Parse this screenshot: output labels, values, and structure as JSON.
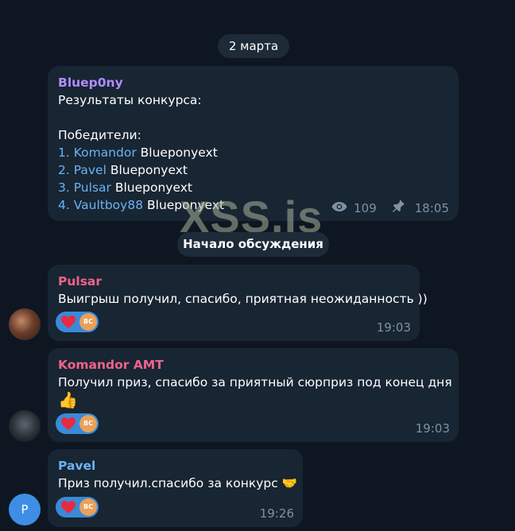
{
  "date_label": "2 марта",
  "watermark": "XSS.is",
  "post": {
    "sender": "Bluep0ny",
    "line1": "Результаты конкурса:",
    "line2": "Победители:",
    "winners": [
      {
        "num": "1.",
        "name": "Komandor",
        "suffix": "Blueponyext"
      },
      {
        "num": "2.",
        "name": "Pavel",
        "suffix": " Blueponyext"
      },
      {
        "num": "3.",
        "name": "Pulsar",
        "suffix": "Blueponyext"
      },
      {
        "num": "4.",
        "name": "Vaultboy88",
        "suffix": "Blueponyext"
      }
    ],
    "views": "109",
    "time": "18:05",
    "sender_color": "#b18cff",
    "link_color": "#6ab3f3"
  },
  "discussion_label": "Начало обсуждения",
  "comments": [
    {
      "sender": "Pulsar",
      "sender_color": "#f1628b",
      "text": "Выигрыш получил, спасибо, приятная неожиданность ))",
      "reaction_avatar": "ВС",
      "time": "19:03"
    },
    {
      "sender": "Komandor AMT",
      "sender_color": "#f1628b",
      "text": "Получил приз, спасибо за приятный сюрприз под конец дня",
      "emoji": "👍",
      "reaction_avatar": "ВС",
      "time": "19:03"
    },
    {
      "sender": "Pavel",
      "sender_color": "#6ab3f3",
      "text": "Приз получил.спасибо за конкурс 🤝",
      "avatar_letter": "P",
      "reaction_avatar": "ВС",
      "time": "19:26"
    }
  ],
  "icons": [
    "eye-icon",
    "pin-icon",
    "heart-icon"
  ]
}
